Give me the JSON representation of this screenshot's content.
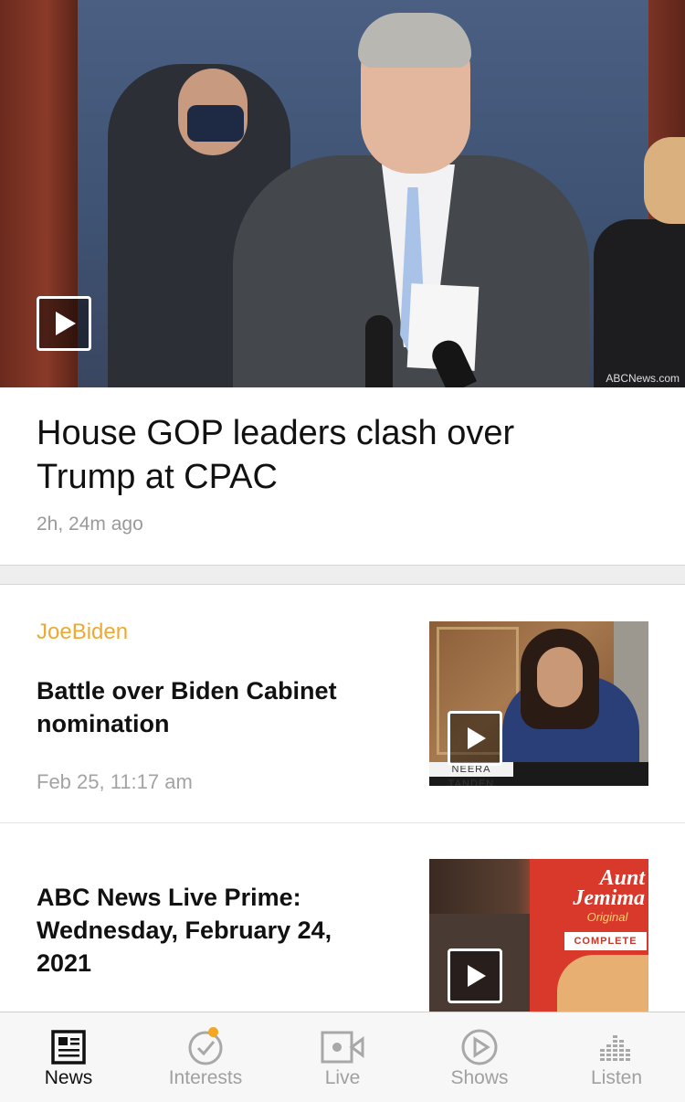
{
  "hero": {
    "watermark": "ABCNews.com",
    "title": "House GOP leaders clash over Trump at CPAC",
    "time": "2h, 24m ago"
  },
  "stories": [
    {
      "tag": "JoeBiden",
      "headline": "Battle over Biden Cabinet nomination",
      "time": "Feb 25, 11:17 am",
      "thumb_caption": "NEERA TANDEN"
    },
    {
      "headline": "ABC News Live Prime: Wednesday, February 24, 2021",
      "thumb_brand": "Aunt Jemima",
      "thumb_sub": "Original",
      "thumb_complete": "COMPLETE"
    }
  ],
  "tabs": [
    {
      "label": "News",
      "icon": "newspaper-icon",
      "active": true
    },
    {
      "label": "Interests",
      "icon": "check-circle-icon",
      "active": false
    },
    {
      "label": "Live",
      "icon": "video-camera-icon",
      "active": false
    },
    {
      "label": "Shows",
      "icon": "play-circle-icon",
      "active": false
    },
    {
      "label": "Listen",
      "icon": "equalizer-icon",
      "active": false
    }
  ],
  "colors": {
    "accent_tag": "#f0a930",
    "notification_dot": "#f5a623",
    "tab_active": "#111111",
    "tab_inactive": "#a0a0a0"
  }
}
